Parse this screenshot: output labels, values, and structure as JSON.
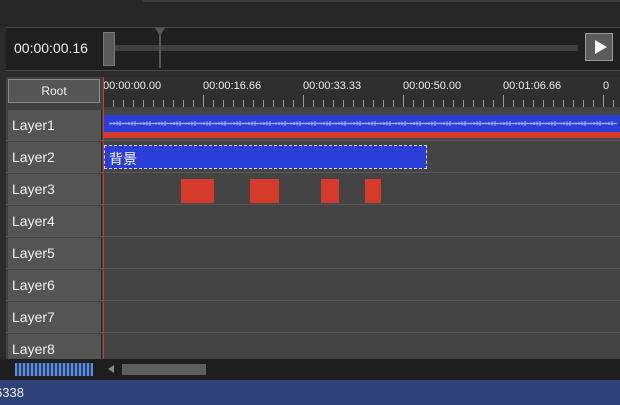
{
  "transport": {
    "time": "00:00:00.16",
    "play_icon": "play-icon"
  },
  "timeline": {
    "root_label": "Root",
    "ruler_labels": [
      "00:00:00.00",
      "00:00:16.66",
      "00:00:33.33",
      "00:00:50.00",
      "00:01:06.66",
      "0"
    ]
  },
  "layers": [
    {
      "name": "Layer1"
    },
    {
      "name": "Layer2"
    },
    {
      "name": "Layer3"
    },
    {
      "name": "Layer4"
    },
    {
      "name": "Layer5"
    },
    {
      "name": "Layer6"
    },
    {
      "name": "Layer7"
    },
    {
      "name": "Layer8"
    }
  ],
  "clips": {
    "layer2_clip_label": "背景"
  },
  "status": {
    "text": "6338"
  },
  "colors": {
    "audio_blue": "#2a3dd6",
    "audio_red": "#d63a2a",
    "clip_blue": "#2a3dd6",
    "status_bar": "#2f4178",
    "playhead": "#d13838"
  }
}
